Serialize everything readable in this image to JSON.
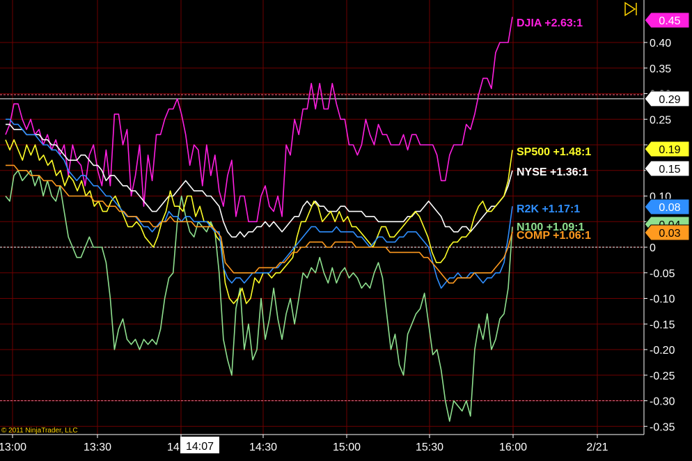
{
  "chart_data": {
    "type": "line",
    "ylim": [
      -0.36,
      0.46
    ],
    "grid": true,
    "y_ticks": [
      "0.40",
      "0.35",
      "0.30",
      "0.25",
      "0.20",
      "0.15",
      "0.10",
      "0.05",
      "0",
      "-0.05",
      "-0.10",
      "-0.15",
      "-0.20",
      "-0.25",
      "-0.30",
      "-0.35"
    ],
    "x_ticks": [
      "13:00",
      "13:30",
      "14:00",
      "14:30",
      "15:00",
      "15:30",
      "16:00",
      "2/21"
    ],
    "cursor_time_label": "14:07",
    "copyright": "© 2011 NinjaTrader, LLC",
    "reference_lines": [
      {
        "value": 0.298,
        "style": "dashed",
        "color": "#ff6a8a"
      },
      {
        "value": 0.29,
        "style": "solid",
        "color": "#ffffff"
      },
      {
        "value": 0.0,
        "style": "dashed",
        "color": "#ffffff"
      },
      {
        "value": -0.3,
        "style": "dashed",
        "color": "#ff6a8a"
      }
    ],
    "series": [
      {
        "name": "N100 +1.09:1",
        "tag": "0.04",
        "color": "#8fe08f",
        "values": [
          0.1,
          0.09,
          0.14,
          0.15,
          0.13,
          0.14,
          0.15,
          0.12,
          0.14,
          0.1,
          0.13,
          0.1,
          0.09,
          0.12,
          0.07,
          0.02,
          0.0,
          -0.02,
          -0.02,
          0.0,
          0.02,
          0.0,
          0.0,
          0.0,
          -0.03,
          -0.1,
          -0.2,
          -0.16,
          -0.14,
          -0.18,
          -0.19,
          -0.18,
          -0.2,
          -0.18,
          -0.19,
          -0.18,
          -0.19,
          -0.16,
          -0.1,
          -0.06,
          -0.05,
          0.05,
          0.1,
          0.06,
          0.03,
          0.02,
          0.05,
          0.04,
          0.03,
          0.05,
          0.03,
          -0.05,
          -0.18,
          -0.22,
          -0.25,
          -0.12,
          -0.08,
          -0.2,
          -0.15,
          -0.22,
          -0.2,
          -0.1,
          -0.18,
          -0.14,
          -0.08,
          -0.14,
          -0.18,
          -0.13,
          -0.1,
          -0.15,
          -0.1,
          -0.05,
          -0.06,
          -0.04,
          -0.05,
          -0.02,
          -0.05,
          -0.07,
          -0.04,
          -0.07,
          -0.05,
          -0.04,
          -0.06,
          -0.05,
          -0.06,
          -0.08,
          -0.07,
          -0.08,
          -0.05,
          -0.03,
          -0.06,
          -0.13,
          -0.2,
          -0.17,
          -0.23,
          -0.25,
          -0.17,
          -0.15,
          -0.13,
          -0.12,
          -0.09,
          -0.15,
          -0.21,
          -0.2,
          -0.24,
          -0.3,
          -0.34,
          -0.3,
          -0.31,
          -0.32,
          -0.3,
          -0.33,
          -0.2,
          -0.15,
          -0.18,
          -0.13,
          -0.2,
          -0.18,
          -0.14,
          -0.13,
          -0.08,
          0.04
        ]
      },
      {
        "name": "DJIA +2.63:1",
        "tag": "0.45",
        "color": "#ff1fe0",
        "values": [
          0.22,
          0.24,
          0.28,
          0.28,
          0.25,
          0.23,
          0.25,
          0.22,
          0.23,
          0.2,
          0.22,
          0.19,
          0.21,
          0.18,
          0.2,
          0.14,
          0.2,
          0.17,
          0.16,
          0.12,
          0.18,
          0.2,
          0.15,
          0.12,
          0.19,
          0.12,
          0.26,
          0.26,
          0.2,
          0.23,
          0.1,
          0.14,
          0.2,
          0.08,
          0.18,
          0.13,
          0.22,
          0.22,
          0.25,
          0.27,
          0.27,
          0.29,
          0.26,
          0.22,
          0.16,
          0.2,
          0.19,
          0.12,
          0.2,
          0.14,
          0.18,
          0.11,
          0.08,
          0.14,
          0.17,
          0.06,
          0.1,
          0.1,
          0.05,
          0.05,
          0.05,
          0.1,
          0.12,
          0.08,
          0.07,
          0.1,
          0.06,
          0.2,
          0.18,
          0.25,
          0.22,
          0.27,
          0.27,
          0.32,
          0.27,
          0.32,
          0.27,
          0.27,
          0.32,
          0.28,
          0.25,
          0.25,
          0.2,
          0.2,
          0.18,
          0.2,
          0.25,
          0.22,
          0.2,
          0.24,
          0.22,
          0.22,
          0.2,
          0.2,
          0.2,
          0.22,
          0.19,
          0.22,
          0.22,
          0.2,
          0.2,
          0.2,
          0.2,
          0.18,
          0.13,
          0.13,
          0.18,
          0.2,
          0.2,
          0.2,
          0.24,
          0.23,
          0.26,
          0.3,
          0.33,
          0.33,
          0.31,
          0.38,
          0.4,
          0.4,
          0.4,
          0.45
        ]
      },
      {
        "name": "NYSE +1.36:1",
        "tag": "0.15",
        "color": "#ffffff",
        "values": [
          0.24,
          0.24,
          0.23,
          0.23,
          0.23,
          0.22,
          0.22,
          0.22,
          0.22,
          0.21,
          0.21,
          0.2,
          0.2,
          0.19,
          0.18,
          0.17,
          0.17,
          0.17,
          0.18,
          0.18,
          0.17,
          0.16,
          0.16,
          0.15,
          0.13,
          0.14,
          0.14,
          0.13,
          0.12,
          0.12,
          0.11,
          0.11,
          0.1,
          0.09,
          0.08,
          0.07,
          0.07,
          0.08,
          0.09,
          0.1,
          0.1,
          0.11,
          0.12,
          0.13,
          0.12,
          0.11,
          0.11,
          0.11,
          0.1,
          0.1,
          0.09,
          0.08,
          0.05,
          0.03,
          0.02,
          0.02,
          0.03,
          0.02,
          0.03,
          0.03,
          0.04,
          0.04,
          0.05,
          0.04,
          0.05,
          0.04,
          0.03,
          0.04,
          0.05,
          0.06,
          0.06,
          0.08,
          0.09,
          0.08,
          0.09,
          0.08,
          0.08,
          0.07,
          0.07,
          0.07,
          0.08,
          0.08,
          0.07,
          0.07,
          0.07,
          0.07,
          0.06,
          0.06,
          0.06,
          0.05,
          0.05,
          0.05,
          0.05,
          0.05,
          0.05,
          0.05,
          0.06,
          0.06,
          0.07,
          0.07,
          0.08,
          0.09,
          0.08,
          0.07,
          0.06,
          0.04,
          0.04,
          0.03,
          0.03,
          0.04,
          0.04,
          0.03,
          0.04,
          0.05,
          0.06,
          0.07,
          0.08,
          0.08,
          0.09,
          0.1,
          0.12,
          0.15
        ]
      },
      {
        "name": "SP500 +1.48:1",
        "tag": "0.19",
        "color": "#ffff28",
        "values": [
          0.21,
          0.19,
          0.21,
          0.19,
          0.17,
          0.2,
          0.18,
          0.2,
          0.17,
          0.18,
          0.16,
          0.17,
          0.14,
          0.15,
          0.12,
          0.14,
          0.13,
          0.11,
          0.13,
          0.1,
          0.11,
          0.08,
          0.09,
          0.07,
          0.07,
          0.09,
          0.1,
          0.08,
          0.06,
          0.04,
          0.04,
          0.05,
          0.04,
          0.02,
          0.01,
          0.0,
          0.02,
          0.05,
          0.07,
          0.11,
          0.08,
          0.08,
          0.07,
          0.1,
          0.1,
          0.06,
          0.08,
          0.05,
          0.05,
          0.04,
          0.02,
          0.01,
          -0.07,
          -0.1,
          -0.11,
          -0.1,
          -0.08,
          -0.11,
          -0.1,
          -0.06,
          -0.07,
          -0.05,
          -0.05,
          -0.06,
          -0.05,
          -0.05,
          -0.04,
          -0.03,
          -0.02,
          0.02,
          0.05,
          0.05,
          0.07,
          0.09,
          0.08,
          0.05,
          0.06,
          0.07,
          0.05,
          0.07,
          0.05,
          0.06,
          0.04,
          0.04,
          0.03,
          0.02,
          0.01,
          0.0,
          0.02,
          0.04,
          0.04,
          0.02,
          0.02,
          0.03,
          0.04,
          0.05,
          0.06,
          0.07,
          0.06,
          0.04,
          0.02,
          -0.01,
          -0.03,
          -0.03,
          -0.02,
          0.0,
          0.01,
          0.01,
          0.02,
          0.02,
          0.03,
          0.06,
          0.08,
          0.09,
          0.07,
          0.07,
          0.08,
          0.09,
          0.1,
          0.13,
          0.19
        ]
      },
      {
        "name": "R2K +1.17:1",
        "tag": "0.08",
        "color": "#2f8fff",
        "values": [
          0.25,
          0.25,
          0.24,
          0.24,
          0.23,
          0.22,
          0.22,
          0.22,
          0.21,
          0.2,
          0.2,
          0.19,
          0.19,
          0.18,
          0.17,
          0.15,
          0.14,
          0.13,
          0.14,
          0.14,
          0.13,
          0.12,
          0.12,
          0.11,
          0.1,
          0.1,
          0.09,
          0.08,
          0.07,
          0.06,
          0.06,
          0.06,
          0.05,
          0.04,
          0.04,
          0.03,
          0.04,
          0.05,
          0.05,
          0.07,
          0.06,
          0.06,
          0.05,
          0.06,
          0.06,
          0.05,
          0.05,
          0.05,
          0.05,
          0.04,
          0.03,
          0.03,
          -0.04,
          -0.06,
          -0.07,
          -0.06,
          -0.06,
          -0.07,
          -0.06,
          -0.05,
          -0.05,
          -0.05,
          -0.05,
          -0.05,
          -0.04,
          -0.04,
          -0.03,
          -0.02,
          -0.01,
          0.0,
          0.01,
          0.02,
          0.03,
          0.04,
          0.04,
          0.03,
          0.03,
          0.03,
          0.03,
          0.04,
          0.03,
          0.03,
          0.03,
          0.03,
          0.02,
          0.02,
          0.01,
          0.0,
          0.01,
          0.02,
          0.02,
          0.01,
          0.01,
          0.01,
          0.02,
          0.02,
          0.03,
          0.03,
          0.03,
          0.02,
          0.01,
          0.0,
          -0.03,
          -0.06,
          -0.08,
          -0.07,
          -0.06,
          -0.06,
          -0.05,
          -0.06,
          -0.06,
          -0.05,
          -0.05,
          -0.06,
          -0.07,
          -0.06,
          -0.06,
          -0.05,
          -0.05,
          -0.03,
          0.02,
          0.08
        ]
      },
      {
        "name": "COMP +1.06:1",
        "tag": "0.03",
        "color": "#ff9a1f",
        "values": [
          0.16,
          0.16,
          0.16,
          0.15,
          0.15,
          0.15,
          0.14,
          0.14,
          0.14,
          0.13,
          0.13,
          0.13,
          0.12,
          0.12,
          0.11,
          0.1,
          0.1,
          0.1,
          0.1,
          0.1,
          0.1,
          0.09,
          0.09,
          0.09,
          0.08,
          0.08,
          0.08,
          0.07,
          0.07,
          0.06,
          0.06,
          0.06,
          0.05,
          0.05,
          0.05,
          0.04,
          0.04,
          0.05,
          0.05,
          0.06,
          0.05,
          0.05,
          0.05,
          0.05,
          0.05,
          0.04,
          0.04,
          0.04,
          0.04,
          0.04,
          0.03,
          0.02,
          -0.03,
          -0.04,
          -0.05,
          -0.05,
          -0.05,
          -0.05,
          -0.05,
          -0.05,
          -0.04,
          -0.04,
          -0.04,
          -0.04,
          -0.04,
          -0.03,
          -0.03,
          -0.02,
          -0.01,
          -0.01,
          0.0,
          0.0,
          0.01,
          0.01,
          0.01,
          0.01,
          0.0,
          0.0,
          0.01,
          0.01,
          0.01,
          0.01,
          0.01,
          0.0,
          0.0,
          0.0,
          0.0,
          0.0,
          0.0,
          0.0,
          0.0,
          -0.01,
          -0.01,
          -0.01,
          -0.01,
          -0.01,
          -0.01,
          -0.01,
          -0.01,
          -0.02,
          -0.02,
          -0.03,
          -0.04,
          -0.05,
          -0.06,
          -0.07,
          -0.07,
          -0.06,
          -0.06,
          -0.06,
          -0.06,
          -0.05,
          -0.05,
          -0.05,
          -0.05,
          -0.05,
          -0.04,
          -0.03,
          -0.02,
          0.0,
          0.03
        ]
      }
    ],
    "label_colors": {
      "grid": "#6e0000",
      "reference_pink": "#ff6a8a"
    }
  }
}
